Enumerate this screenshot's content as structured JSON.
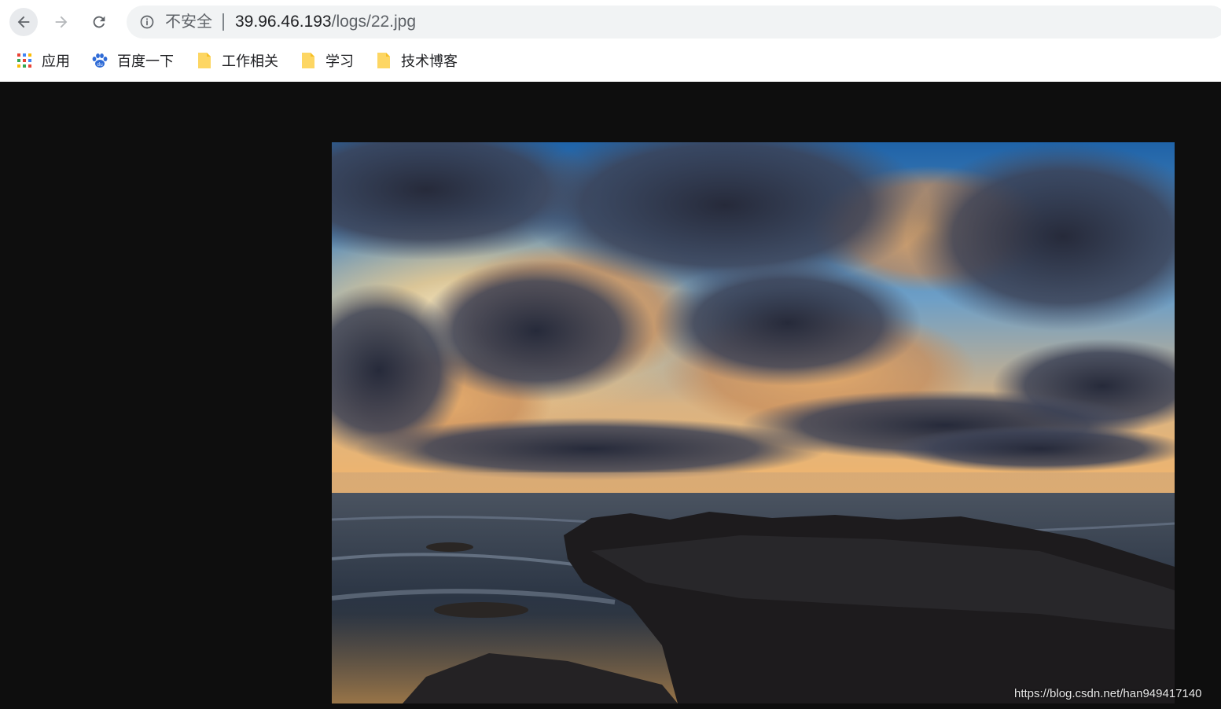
{
  "omnibox": {
    "security_label": "不安全",
    "url_host": "39.96.46.193",
    "url_path": "/logs/22.jpg"
  },
  "bookmarks": [
    {
      "label": "应用",
      "icon": "apps-grid-icon"
    },
    {
      "label": "百度一下",
      "icon": "baidu-paw-icon"
    },
    {
      "label": "工作相关",
      "icon": "folder-icon"
    },
    {
      "label": "学习",
      "icon": "folder-icon"
    },
    {
      "label": "技术博客",
      "icon": "folder-icon"
    }
  ],
  "image": {
    "description_icon": "seascape-sunset-photo"
  },
  "watermark": "https://blog.csdn.net/han949417140",
  "colors": {
    "page_background": "#0e0e0e",
    "chrome_background": "#ffffff",
    "omnibox_background": "#f1f3f4",
    "folder_yellow": "#fdd663"
  }
}
